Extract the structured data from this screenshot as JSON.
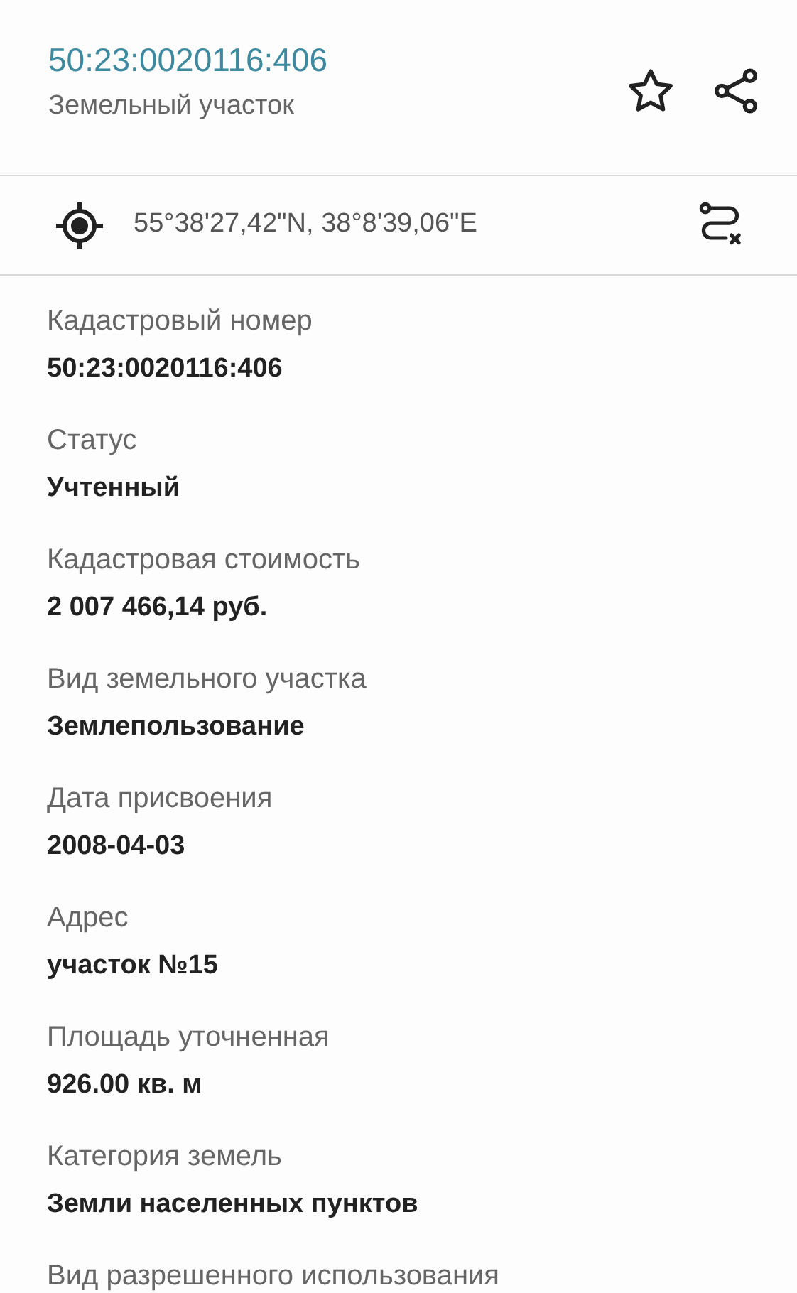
{
  "header": {
    "title": "50:23:0020116:406",
    "subtitle": "Земельный участок"
  },
  "coordinates": {
    "text": "55°38'27,42\"N, 38°8'39,06\"E"
  },
  "fields": [
    {
      "label": "Кадастровый номер",
      "value": "50:23:0020116:406"
    },
    {
      "label": "Статус",
      "value": "Учтенный"
    },
    {
      "label": "Кадастровая стоимость",
      "value": "2 007 466,14 руб."
    },
    {
      "label": "Вид земельного участка",
      "value": "Землепользование"
    },
    {
      "label": "Дата присвоения",
      "value": "2008-04-03"
    },
    {
      "label": "Адрес",
      "value": "участок №15"
    },
    {
      "label": "Площадь уточненная",
      "value": "926.00 кв. м"
    },
    {
      "label": "Категория земель",
      "value": "Земли населенных пунктов"
    },
    {
      "label": "Вид разрешенного использования"
    }
  ]
}
